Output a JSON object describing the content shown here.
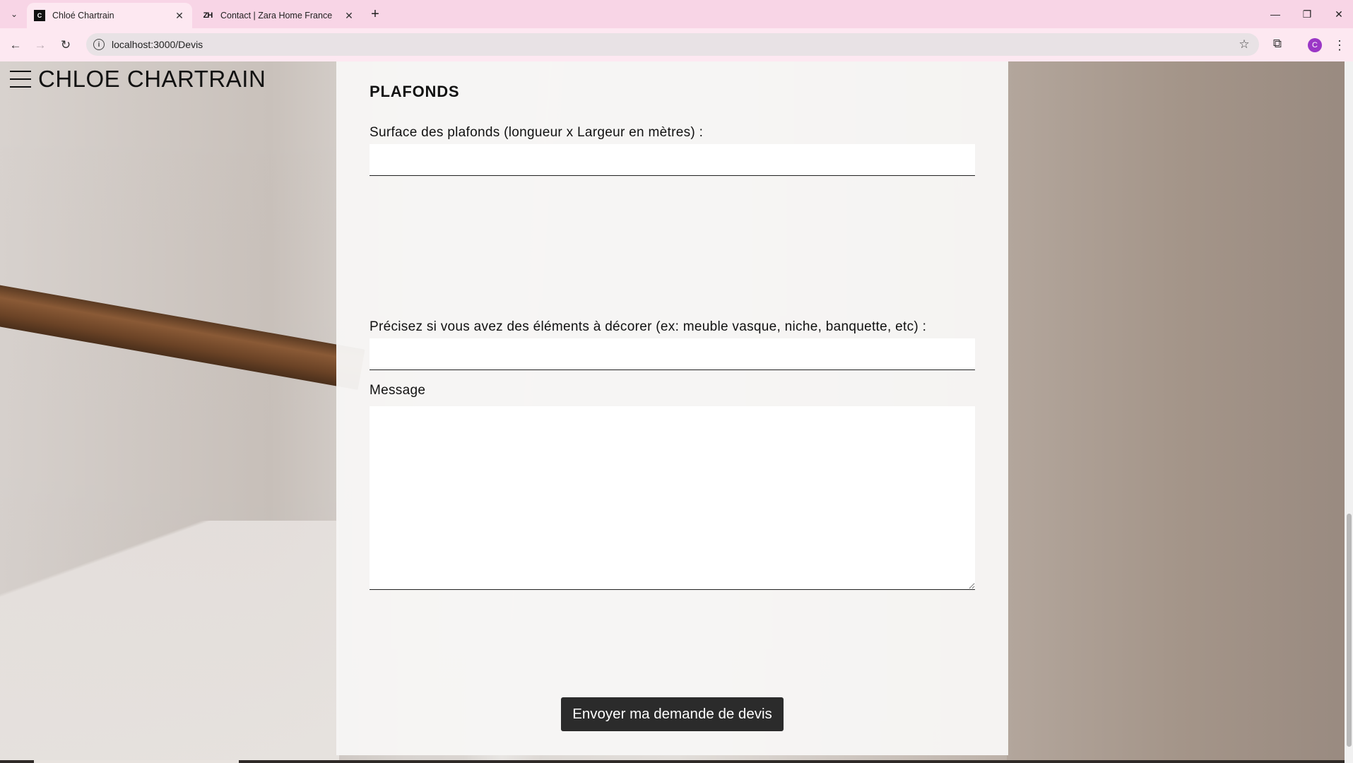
{
  "browser": {
    "tabs": [
      {
        "title": "Chloé Chartrain",
        "favicon": "C",
        "active": true
      },
      {
        "title": "Contact | Zara Home France",
        "favicon": "ZH",
        "active": false
      }
    ],
    "url": "localhost:3000/Devis",
    "profile_initial": "C",
    "accent": "#f8d5e6"
  },
  "site": {
    "logo": "CHLOE CHARTRAIN"
  },
  "form": {
    "section_title": "PLAFONDS",
    "surface_label": "Surface des plafonds (longueur x Largeur en mètres) :",
    "elements_label": "Précisez si vous avez des éléments à décorer (ex: meuble vasque, niche, banquette, etc) :",
    "message_label": "Message",
    "submit_label": "Envoyer ma demande de devis"
  }
}
